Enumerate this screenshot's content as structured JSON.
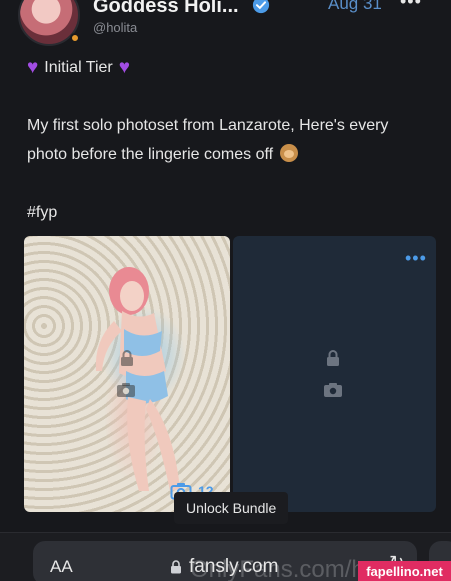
{
  "post": {
    "author_name": "Goddess Holi...",
    "handle": "@holita",
    "date": "Aug 31",
    "more_icon": "more-horizontal-icon",
    "tier_label": "Initial Tier",
    "tier_icon": "purple-heart-icon",
    "body_text": "My first solo photoset from Lanzarote, Here's every photo before the lingerie comes off",
    "body_emoji": "see-no-evil-monkey-icon",
    "hashtag": "#fyp",
    "media_count": "12",
    "unlock_label": "Unlock Bundle",
    "media_more_icon": "more-dots-icon"
  },
  "browser": {
    "text_size_label": "AA",
    "url": "fansly.com",
    "reload_icon": "reload-icon"
  },
  "overlay": {
    "watermark_text": "OnlyFans.com/h",
    "badge_text": "fapellino.net"
  },
  "colors": {
    "accent": "#4c9be8",
    "date": "#5a8fc9",
    "heart": "#a24de3",
    "badge": "#e02c62",
    "background": "#17181c"
  }
}
